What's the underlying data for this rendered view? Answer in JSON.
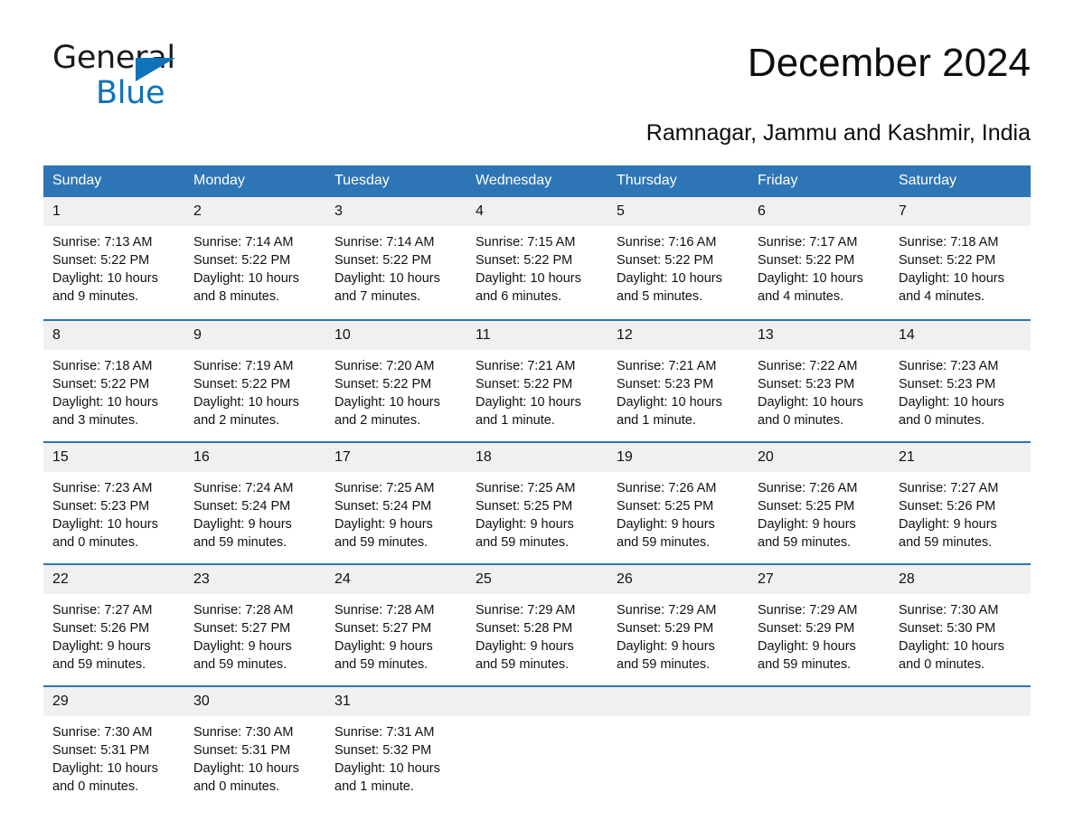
{
  "logo": {
    "word1": "General",
    "word2": "Blue",
    "triangle_color": "#1072b9"
  },
  "header": {
    "title": "December 2024",
    "subtitle": "Ramnagar, Jammu and Kashmir, India"
  },
  "colors": {
    "header_blue": "#2e75b6",
    "daynum_gray": "#f0f0f0",
    "text": "#111111"
  },
  "calendar": {
    "weekdays": [
      "Sunday",
      "Monday",
      "Tuesday",
      "Wednesday",
      "Thursday",
      "Friday",
      "Saturday"
    ],
    "weeks": [
      [
        {
          "day": "1",
          "info": "Sunrise: 7:13 AM\nSunset: 5:22 PM\nDaylight: 10 hours\nand 9 minutes."
        },
        {
          "day": "2",
          "info": "Sunrise: 7:14 AM\nSunset: 5:22 PM\nDaylight: 10 hours\nand 8 minutes."
        },
        {
          "day": "3",
          "info": "Sunrise: 7:14 AM\nSunset: 5:22 PM\nDaylight: 10 hours\nand 7 minutes."
        },
        {
          "day": "4",
          "info": "Sunrise: 7:15 AM\nSunset: 5:22 PM\nDaylight: 10 hours\nand 6 minutes."
        },
        {
          "day": "5",
          "info": "Sunrise: 7:16 AM\nSunset: 5:22 PM\nDaylight: 10 hours\nand 5 minutes."
        },
        {
          "day": "6",
          "info": "Sunrise: 7:17 AM\nSunset: 5:22 PM\nDaylight: 10 hours\nand 4 minutes."
        },
        {
          "day": "7",
          "info": "Sunrise: 7:18 AM\nSunset: 5:22 PM\nDaylight: 10 hours\nand 4 minutes."
        }
      ],
      [
        {
          "day": "8",
          "info": "Sunrise: 7:18 AM\nSunset: 5:22 PM\nDaylight: 10 hours\nand 3 minutes."
        },
        {
          "day": "9",
          "info": "Sunrise: 7:19 AM\nSunset: 5:22 PM\nDaylight: 10 hours\nand 2 minutes."
        },
        {
          "day": "10",
          "info": "Sunrise: 7:20 AM\nSunset: 5:22 PM\nDaylight: 10 hours\nand 2 minutes."
        },
        {
          "day": "11",
          "info": "Sunrise: 7:21 AM\nSunset: 5:22 PM\nDaylight: 10 hours\nand 1 minute."
        },
        {
          "day": "12",
          "info": "Sunrise: 7:21 AM\nSunset: 5:23 PM\nDaylight: 10 hours\nand 1 minute."
        },
        {
          "day": "13",
          "info": "Sunrise: 7:22 AM\nSunset: 5:23 PM\nDaylight: 10 hours\nand 0 minutes."
        },
        {
          "day": "14",
          "info": "Sunrise: 7:23 AM\nSunset: 5:23 PM\nDaylight: 10 hours\nand 0 minutes."
        }
      ],
      [
        {
          "day": "15",
          "info": "Sunrise: 7:23 AM\nSunset: 5:23 PM\nDaylight: 10 hours\nand 0 minutes."
        },
        {
          "day": "16",
          "info": "Sunrise: 7:24 AM\nSunset: 5:24 PM\nDaylight: 9 hours\nand 59 minutes."
        },
        {
          "day": "17",
          "info": "Sunrise: 7:25 AM\nSunset: 5:24 PM\nDaylight: 9 hours\nand 59 minutes."
        },
        {
          "day": "18",
          "info": "Sunrise: 7:25 AM\nSunset: 5:25 PM\nDaylight: 9 hours\nand 59 minutes."
        },
        {
          "day": "19",
          "info": "Sunrise: 7:26 AM\nSunset: 5:25 PM\nDaylight: 9 hours\nand 59 minutes."
        },
        {
          "day": "20",
          "info": "Sunrise: 7:26 AM\nSunset: 5:25 PM\nDaylight: 9 hours\nand 59 minutes."
        },
        {
          "day": "21",
          "info": "Sunrise: 7:27 AM\nSunset: 5:26 PM\nDaylight: 9 hours\nand 59 minutes."
        }
      ],
      [
        {
          "day": "22",
          "info": "Sunrise: 7:27 AM\nSunset: 5:26 PM\nDaylight: 9 hours\nand 59 minutes."
        },
        {
          "day": "23",
          "info": "Sunrise: 7:28 AM\nSunset: 5:27 PM\nDaylight: 9 hours\nand 59 minutes."
        },
        {
          "day": "24",
          "info": "Sunrise: 7:28 AM\nSunset: 5:27 PM\nDaylight: 9 hours\nand 59 minutes."
        },
        {
          "day": "25",
          "info": "Sunrise: 7:29 AM\nSunset: 5:28 PM\nDaylight: 9 hours\nand 59 minutes."
        },
        {
          "day": "26",
          "info": "Sunrise: 7:29 AM\nSunset: 5:29 PM\nDaylight: 9 hours\nand 59 minutes."
        },
        {
          "day": "27",
          "info": "Sunrise: 7:29 AM\nSunset: 5:29 PM\nDaylight: 9 hours\nand 59 minutes."
        },
        {
          "day": "28",
          "info": "Sunrise: 7:30 AM\nSunset: 5:30 PM\nDaylight: 10 hours\nand 0 minutes."
        }
      ],
      [
        {
          "day": "29",
          "info": "Sunrise: 7:30 AM\nSunset: 5:31 PM\nDaylight: 10 hours\nand 0 minutes."
        },
        {
          "day": "30",
          "info": "Sunrise: 7:30 AM\nSunset: 5:31 PM\nDaylight: 10 hours\nand 0 minutes."
        },
        {
          "day": "31",
          "info": "Sunrise: 7:31 AM\nSunset: 5:32 PM\nDaylight: 10 hours\nand 1 minute."
        },
        {
          "day": "",
          "info": ""
        },
        {
          "day": "",
          "info": ""
        },
        {
          "day": "",
          "info": ""
        },
        {
          "day": "",
          "info": ""
        }
      ]
    ]
  }
}
